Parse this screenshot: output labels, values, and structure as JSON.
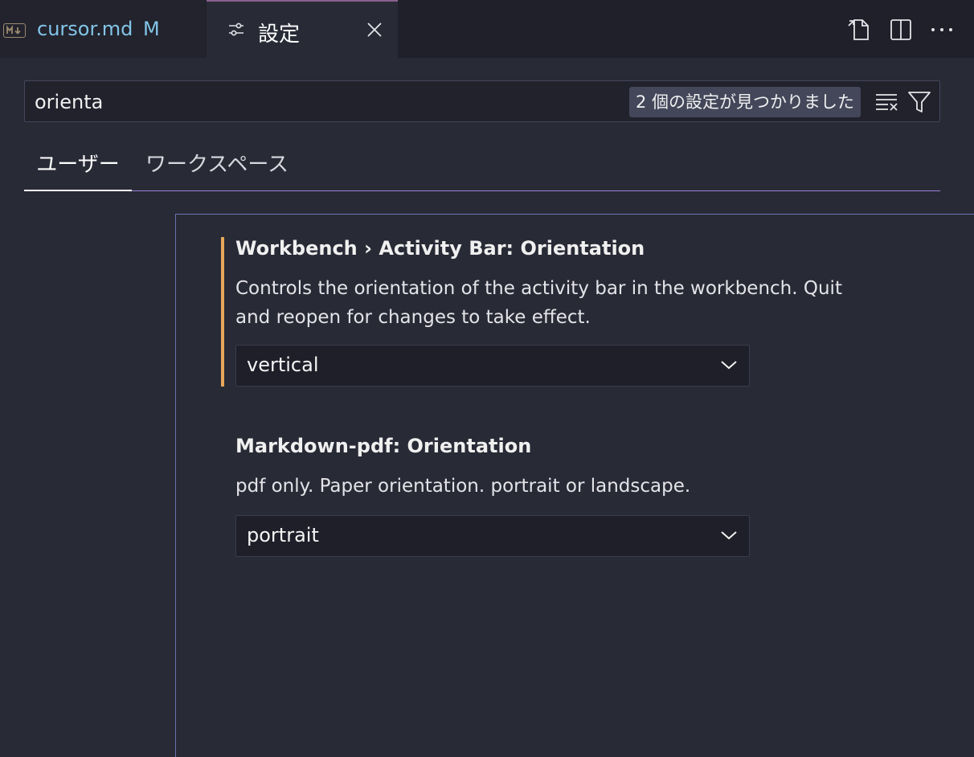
{
  "tabs": {
    "markdown_tab": {
      "label": "cursor.md",
      "modified": "M"
    },
    "settings_tab": {
      "label": "設定"
    }
  },
  "search": {
    "value": "orienta",
    "result_count": "2 個の設定が見つかりました"
  },
  "scope_tabs": {
    "user": "ユーザー",
    "workspace": "ワークスペース"
  },
  "settings": [
    {
      "title": "Workbench › Activity Bar: Orientation",
      "description": "Controls the orientation of the activity bar in the workbench. Quit and reopen for changes to take effect.",
      "value": "vertical",
      "modified": true
    },
    {
      "title": "Markdown-pdf: Orientation",
      "description": "pdf only. Paper orientation. portrait or landscape.",
      "value": "portrait",
      "modified": false
    }
  ],
  "colors": {
    "background": "#282a36",
    "tab_bar": "#1f2029",
    "accent": "#9a7fd8",
    "modified_indicator": "#e8a75a",
    "markdown_tab_text": "#83c5e8"
  },
  "icons": [
    "markdown-icon",
    "settings-sliders-icon",
    "close-icon",
    "open-file-icon",
    "split-editor-icon",
    "more-actions-icon",
    "clear-filter-icon",
    "filter-icon",
    "chevron-down-icon"
  ]
}
